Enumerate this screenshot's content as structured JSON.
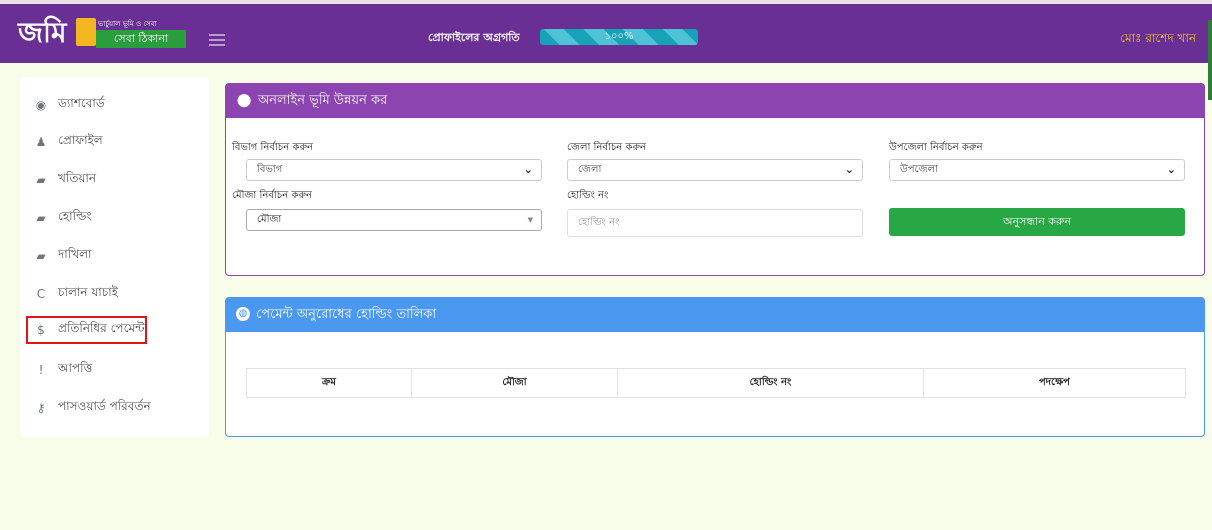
{
  "header": {
    "logo_main": "জমি",
    "logo_tagline_top": "ভার্চুয়াল ভূমি ও সেবা",
    "logo_tagline_box": "সেবা ঠিকানা",
    "profile_progress_label": "প্রোফাইলের অগ্রগতি",
    "profile_progress_value": 1.0,
    "profile_progress_text": "১০০%",
    "user_name": "মোঃ রাশেদ খান"
  },
  "sidebar": {
    "items": [
      {
        "icon": "dashboard-icon",
        "glyph": "◉",
        "label": "ড্যাশবোর্ড"
      },
      {
        "icon": "user-icon",
        "glyph": "♟",
        "label": "প্রোফাইল"
      },
      {
        "icon": "book-icon",
        "glyph": "▰",
        "label": "খতিয়ান"
      },
      {
        "icon": "book-icon",
        "glyph": "▰",
        "label": "হোল্ডিং"
      },
      {
        "icon": "book-icon",
        "glyph": "▰",
        "label": "দাখিলা"
      },
      {
        "icon": "refresh-icon",
        "glyph": "C",
        "label": "চালান যাচাই"
      },
      {
        "icon": "dollar-icon",
        "glyph": "$",
        "label": "প্রতিনিধির পেমেন্ট"
      },
      {
        "icon": "exclamation-icon",
        "glyph": "!",
        "label": "আপত্তি"
      },
      {
        "icon": "key-icon",
        "glyph": "⚷",
        "label": "পাসওয়ার্ড পরিবর্তন"
      }
    ]
  },
  "search_card": {
    "title": "অনলাইন ভূমি উন্নয়ন কর",
    "division_label": "বিভাগ নির্বাচন করুন",
    "division_value": "বিভাগ",
    "district_label": "জেলা নির্বাচন করুন",
    "district_value": "জেলা",
    "upazila_label": "উপজেলা নির্বাচন করুন",
    "upazila_value": "উপজেলা",
    "mouza_label": "মৌজা নির্বাচন করুন",
    "mouza_value": "মৌজা",
    "holding_label": "হোল্ডিং নং",
    "holding_placeholder": "হোল্ডিং নং",
    "search_button": "অনুসন্ধান করুন"
  },
  "payment_card": {
    "title": "পেমেন্ট অনুরোধের হোল্ডিং তালিকা",
    "columns": [
      "ক্রম",
      "মৌজা",
      "হোল্ডিং নং",
      "পদক্ষেপ"
    ]
  },
  "colors": {
    "header_bg": "#6a2f94",
    "search_card_accent": "#8b44b0",
    "payment_card_accent": "#4b98f0",
    "search_button": "#28a745",
    "user_name": "#f3c623",
    "highlight_border": "#e3131b"
  }
}
